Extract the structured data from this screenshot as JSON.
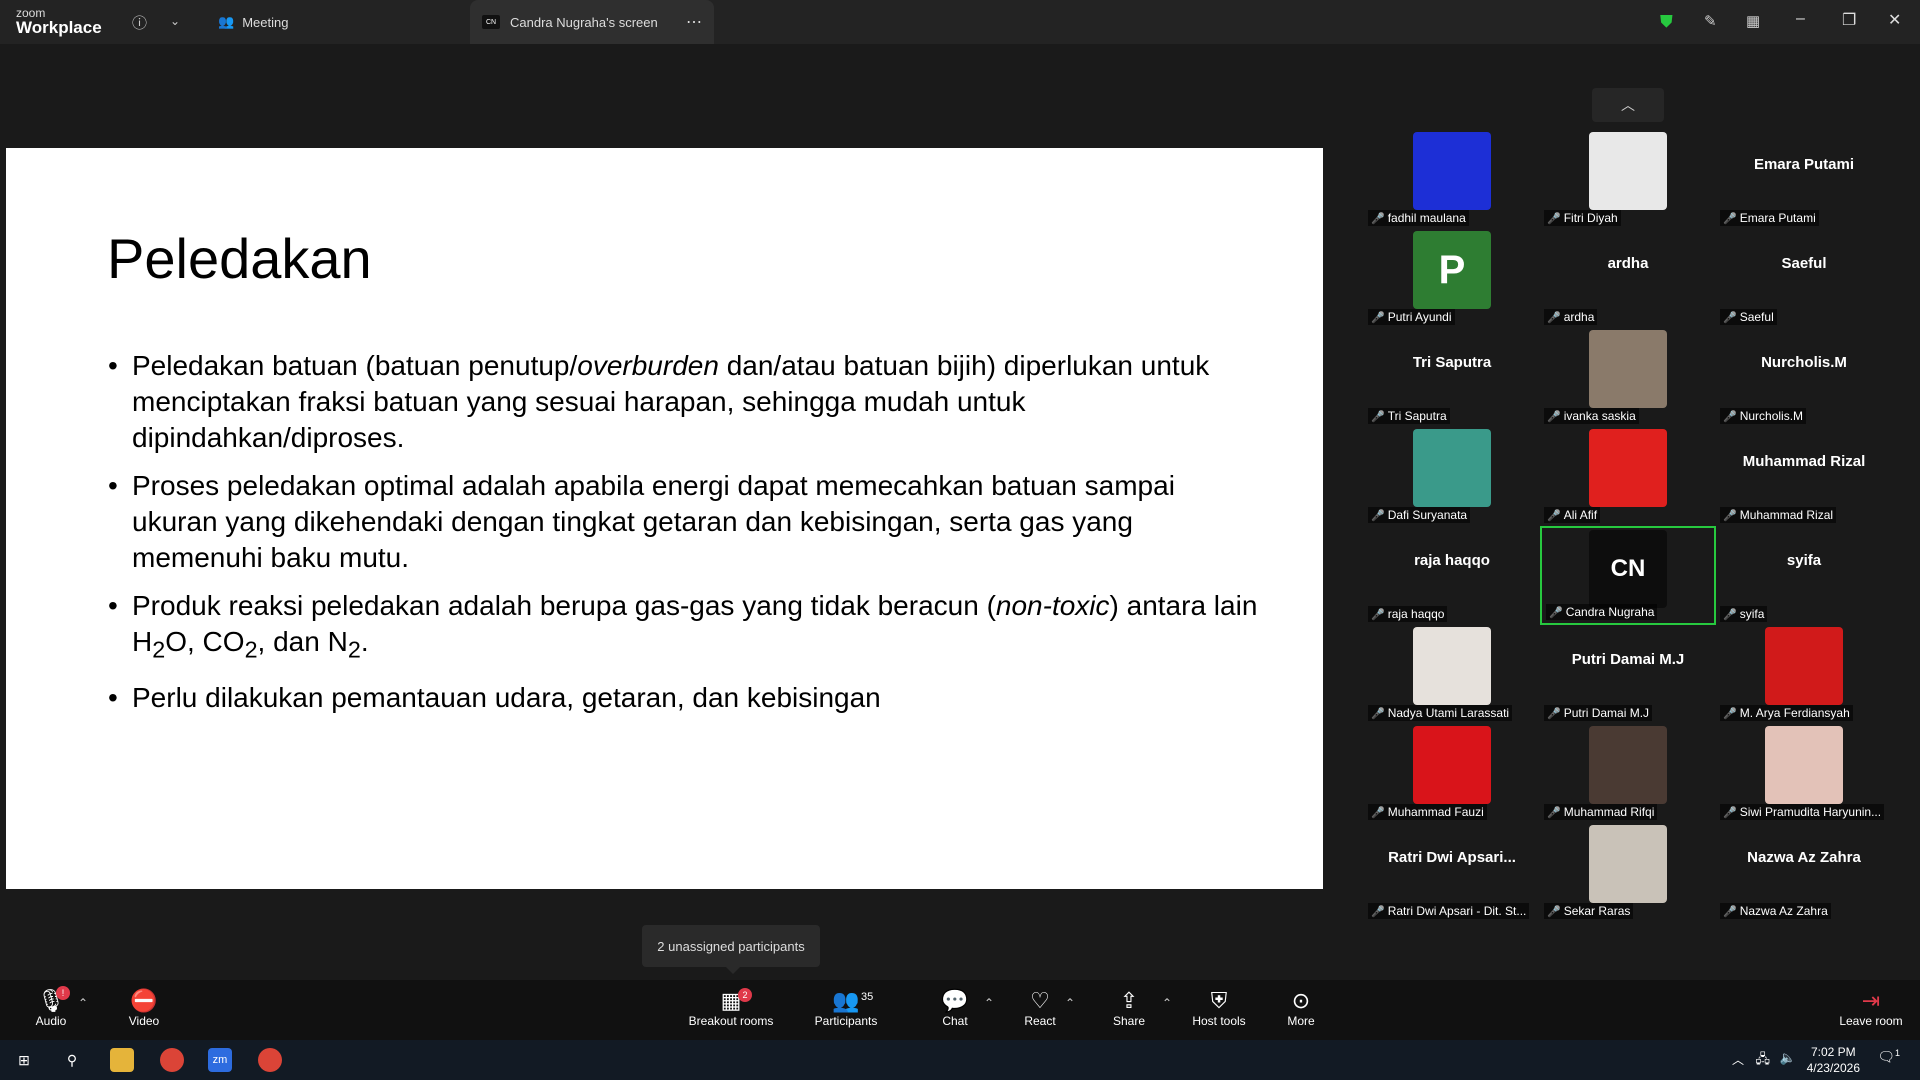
{
  "app": {
    "brand_top": "zoom",
    "brand_bottom": "Workplace"
  },
  "tabs": {
    "meeting": "Meeting",
    "screen": "Candra Nugraha's screen",
    "screen_avatar": "CN"
  },
  "slide": {
    "title": "Peledakan",
    "bullets": [
      {
        "pre": "Peledakan batuan (batuan penutup/",
        "em": "overburden",
        "post": " dan/atau batuan bijih) diperlukan untuk menciptakan fraksi batuan yang sesuai harapan, sehingga mudah untuk dipindahkan/diproses."
      },
      {
        "text": "Proses peledakan optimal adalah apabila energi dapat memecahkan batuan sampai ukuran yang dikehendaki dengan tingkat getaran dan kebisingan, serta gas yang memenuhi baku mutu."
      },
      {
        "pre": "Produk reaksi peledakan adalah berupa gas-gas yang tidak beracun (",
        "em": "non-toxic",
        "post": ") antara lain ",
        "f1": "H",
        "s1": "2",
        "f2": "O, CO",
        "s2": "2",
        "f3": ", dan N",
        "s3": "2",
        "f4": "."
      },
      {
        "text": "Perlu dilakukan pemantauan udara, getaran, dan kebisingan"
      }
    ]
  },
  "participants": [
    {
      "label": "fadhil maulana",
      "photo": "#1d2fd6"
    },
    {
      "label": "Fitri Diyah",
      "photo": "#e8e8e8"
    },
    {
      "label": "Emara Putami",
      "bigname": "Emara Putami"
    },
    {
      "label": "Putri Ayundi",
      "letter": "P",
      "photo": "#2e7d32"
    },
    {
      "label": "ardha",
      "bigname": "ardha"
    },
    {
      "label": "Saeful",
      "bigname": "Saeful"
    },
    {
      "label": "Tri Saputra",
      "bigname": "Tri Saputra"
    },
    {
      "label": "ivanka saskia",
      "photo": "#8a7a6a"
    },
    {
      "label": "Nurcholis.M",
      "bigname": "Nurcholis.M"
    },
    {
      "label": "Dafi Suryanata",
      "photo": "#3a9a8a"
    },
    {
      "label": "Ali Afif",
      "photo": "#e0201e"
    },
    {
      "label": "Muhammad Rizal",
      "bigname": "Muhammad Rizal"
    },
    {
      "label": "raja haqqo",
      "bigname": "raja haqqo"
    },
    {
      "label": "Candra Nugraha",
      "letter": "CN",
      "photo": "#0d0d0d",
      "active": true
    },
    {
      "label": "syifa",
      "bigname": "syifa"
    },
    {
      "label": "Nadya Utami Larassati",
      "photo": "#e6e1dc"
    },
    {
      "label": "Putri Damai M.J",
      "bigname": "Putri Damai M.J"
    },
    {
      "label": "M. Arya Ferdiansyah",
      "photo": "#d11a1a"
    },
    {
      "label": "Muhammad Fauzi",
      "photo": "#d9141a"
    },
    {
      "label": "Muhammad Rifqi",
      "photo": "#4a3a33"
    },
    {
      "label": "Siwi Pramudita Haryunin...",
      "photo": "#e3c2b8"
    },
    {
      "label": "Ratri Dwi Apsari - Dit. St...",
      "bigname": "Ratri Dwi Apsari..."
    },
    {
      "label": "Sekar Raras",
      "photo": "#c9c2b8"
    },
    {
      "label": "Nazwa Az Zahra",
      "bigname": "Nazwa Az Zahra"
    }
  ],
  "tooltip": "2 unassigned participants",
  "toolbar": {
    "audio": "Audio",
    "video": "Video",
    "breakout": "Breakout rooms",
    "breakout_badge": "2",
    "participants": "Participants",
    "participants_count": "35",
    "chat": "Chat",
    "react": "React",
    "share": "Share",
    "host_tools": "Host tools",
    "more": "More",
    "leave": "Leave room"
  },
  "taskbar": {
    "time": "7:02 PM",
    "date": "4/23/2026",
    "zoom_label": "zm",
    "notif": "1"
  },
  "colors": {
    "active_border": "#27c93f",
    "mic_muted": "#e0394a",
    "shield": "#27c93f"
  }
}
